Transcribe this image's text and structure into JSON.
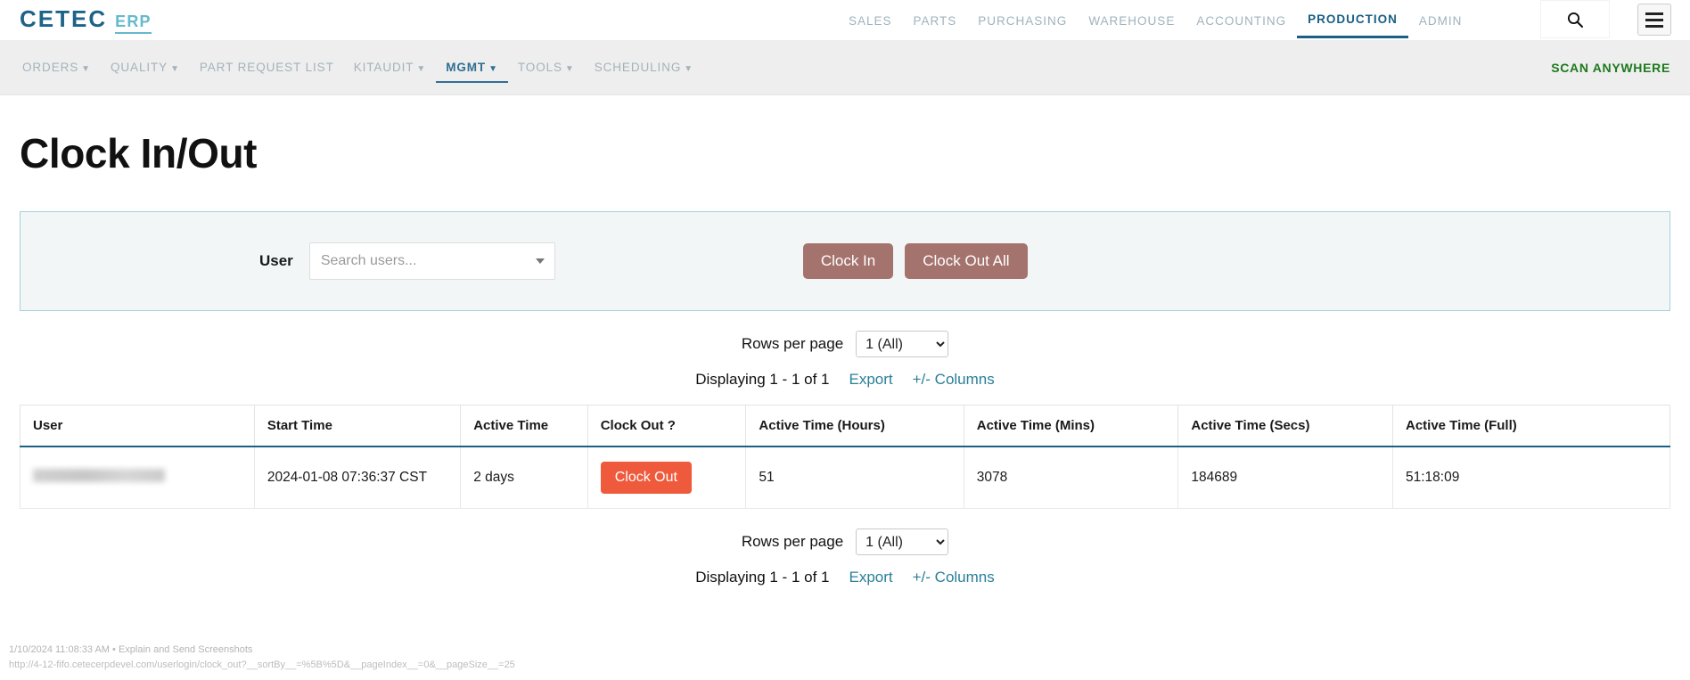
{
  "brand": {
    "name": "CETEC",
    "suffix": "ERP",
    "color_primary": "#1d6389",
    "color_secondary": "#66b9cc"
  },
  "topnav": {
    "items": [
      {
        "label": "SALES",
        "active": false
      },
      {
        "label": "PARTS",
        "active": false
      },
      {
        "label": "PURCHASING",
        "active": false
      },
      {
        "label": "WAREHOUSE",
        "active": false
      },
      {
        "label": "ACCOUNTING",
        "active": false
      },
      {
        "label": "PRODUCTION",
        "active": true
      },
      {
        "label": "ADMIN",
        "active": false
      }
    ],
    "search_icon": "search-icon",
    "menu_icon": "hamburger-icon"
  },
  "subnav": {
    "items": [
      {
        "label": "ORDERS",
        "caret": "▼",
        "active": false
      },
      {
        "label": "QUALITY",
        "caret": "▼",
        "active": false
      },
      {
        "label": "PART REQUEST LIST",
        "caret": "",
        "active": false
      },
      {
        "label": "KITAUDIT",
        "caret": "▼",
        "active": false
      },
      {
        "label": "MGMT",
        "caret": "▼",
        "active": true
      },
      {
        "label": "TOOLS",
        "caret": "▼",
        "active": false
      },
      {
        "label": "SCHEDULING",
        "caret": "▼",
        "active": false
      }
    ],
    "scan_anywhere": "SCAN ANYWHERE",
    "scan_color": "#1d7a1d"
  },
  "page": {
    "title": "Clock In/Out"
  },
  "form": {
    "user_label": "User",
    "user_placeholder": "Search users...",
    "user_value": "",
    "clock_in_label": "Clock In",
    "clock_out_all_label": "Clock Out All",
    "button_color": "#a4736d"
  },
  "pagination_top": {
    "rows_label": "Rows per page",
    "rows_value": "1 (All)",
    "rows_options": [
      "1 (All)"
    ],
    "displaying": "Displaying 1 - 1 of 1",
    "export_label": "Export",
    "plus_minus": "+/-",
    "columns_label": "Columns"
  },
  "pagination_bottom": {
    "rows_label": "Rows per page",
    "rows_value": "1 (All)",
    "rows_options": [
      "1 (All)"
    ],
    "displaying": "Displaying 1 - 1 of 1",
    "export_label": "Export",
    "plus_minus": "+/-",
    "columns_label": "Columns"
  },
  "table": {
    "columns": [
      "User",
      "Start Time",
      "Active Time",
      "Clock Out ?",
      "Active Time (Hours)",
      "Active Time (Mins)",
      "Active Time (Secs)",
      "Active Time (Full)"
    ],
    "rows": [
      {
        "user": "",
        "user_redacted": true,
        "start_time": "2024-01-08 07:36:37 CST",
        "active_time": "2 days",
        "clock_out_label": "Clock Out",
        "clock_out_color": "#f05a3c",
        "active_hours": "51",
        "active_mins": "3078",
        "active_secs": "184689",
        "active_full": "51:18:09"
      }
    ]
  },
  "footer": {
    "timestamp": "1/10/2024 11:08:33 AM",
    "separator": "•",
    "tool_label": "Explain and Send Screenshots",
    "url": "http://4-12-fifo.cetecerpdevel.com/userlogin/clock_out?__sortBy__=%5B%5D&__pageIndex__=0&__pageSize__=25"
  }
}
